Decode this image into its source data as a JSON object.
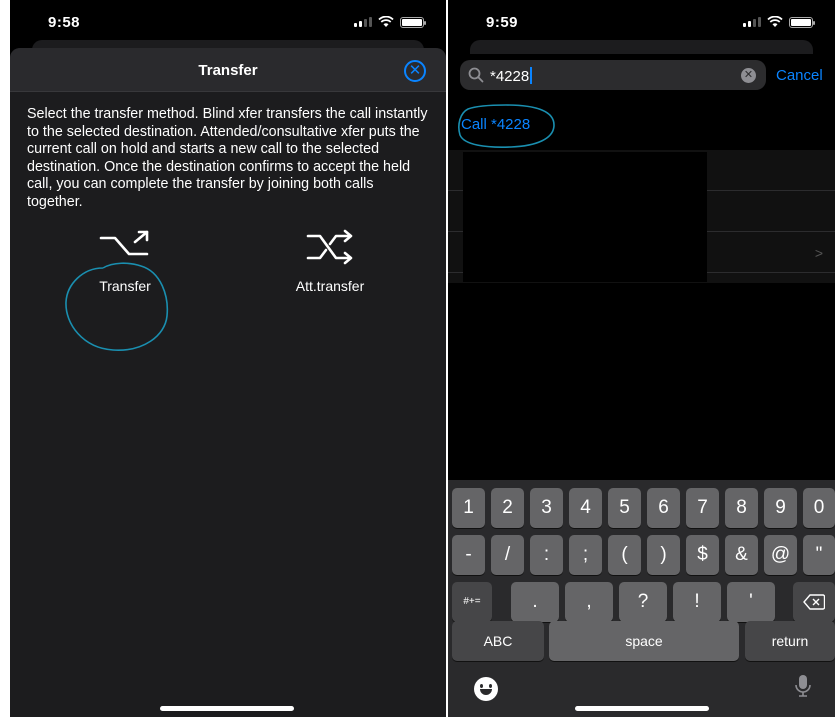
{
  "left": {
    "status": {
      "time": "9:58"
    },
    "header": {
      "title": "Transfer",
      "close_glyph": "✕"
    },
    "description": "Select the transfer method. Blind xfer transfers the call instantly to the selected destination. Attended/consultative xfer puts the current call on hold and starts a new call to the selected destination. Once the destination confirms to accept the held call, you can complete the transfer by joining both calls together.",
    "methods": [
      {
        "label": "Transfer",
        "icon": "blind-transfer-icon"
      },
      {
        "label": "Att.transfer",
        "icon": "attended-transfer-icon"
      }
    ]
  },
  "right": {
    "status": {
      "time": "9:59"
    },
    "search": {
      "value": "*4228",
      "clear_glyph": "✕"
    },
    "cancel_label": "Cancel",
    "call_row": "Call *4228",
    "chevron": ">",
    "keyboard": {
      "row1": [
        "1",
        "2",
        "3",
        "4",
        "5",
        "6",
        "7",
        "8",
        "9",
        "0"
      ],
      "row2": [
        "-",
        "/",
        ":",
        ";",
        "(",
        ")",
        "$",
        "&",
        "@",
        "\""
      ],
      "row3_left": "#+=",
      "row3": [
        ".",
        ",",
        "?",
        "!",
        "'"
      ],
      "row4": {
        "abc": "ABC",
        "space": "space",
        "return": "return"
      }
    }
  },
  "colors": {
    "accent": "#0a84ff",
    "annotation": "#1a8fb0"
  }
}
